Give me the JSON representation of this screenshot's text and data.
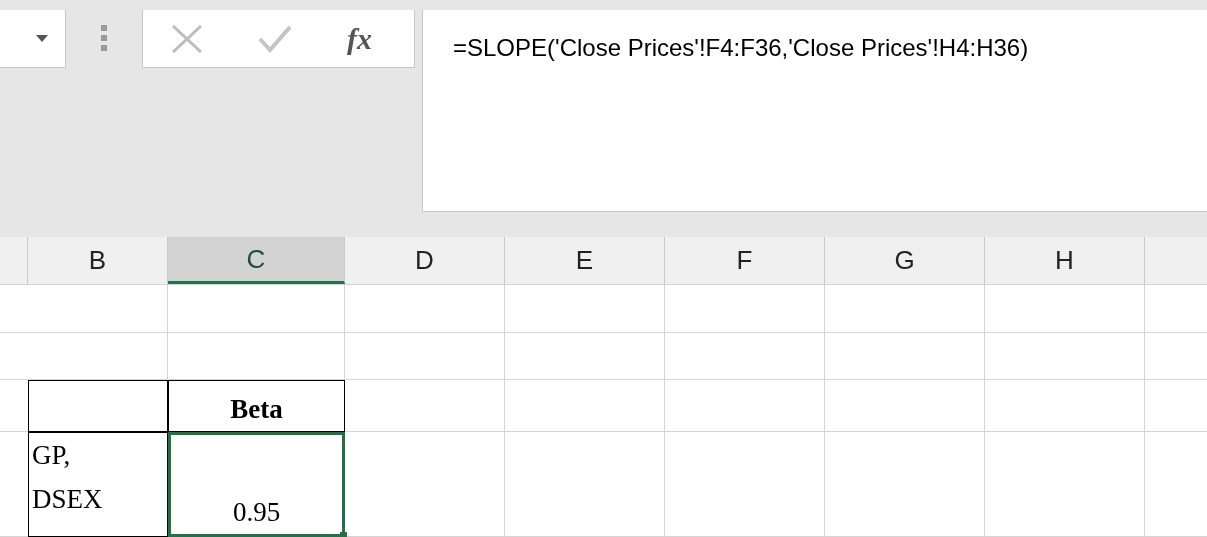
{
  "formula_bar": {
    "function_label": "fx",
    "formula": "=SLOPE('Close Prices'!F4:F36,'Close Prices'!H4:H36)"
  },
  "columns": [
    {
      "label": "B",
      "selected": false
    },
    {
      "label": "C",
      "selected": true
    },
    {
      "label": "D",
      "selected": false
    },
    {
      "label": "E",
      "selected": false
    },
    {
      "label": "F",
      "selected": false
    },
    {
      "label": "G",
      "selected": false
    },
    {
      "label": "H",
      "selected": false
    }
  ],
  "rows": [
    {
      "cells": [
        {
          "boxed": true,
          "active": false
        },
        {
          "text": "Beta",
          "bold": true,
          "boxed": true,
          "active": false
        }
      ]
    },
    {
      "cells": [
        {
          "text": "GP, DSEX",
          "bold": false,
          "boxed": true,
          "active": false
        },
        {
          "text": "0.95",
          "bold": false,
          "boxed": false,
          "active": true
        }
      ]
    }
  ]
}
